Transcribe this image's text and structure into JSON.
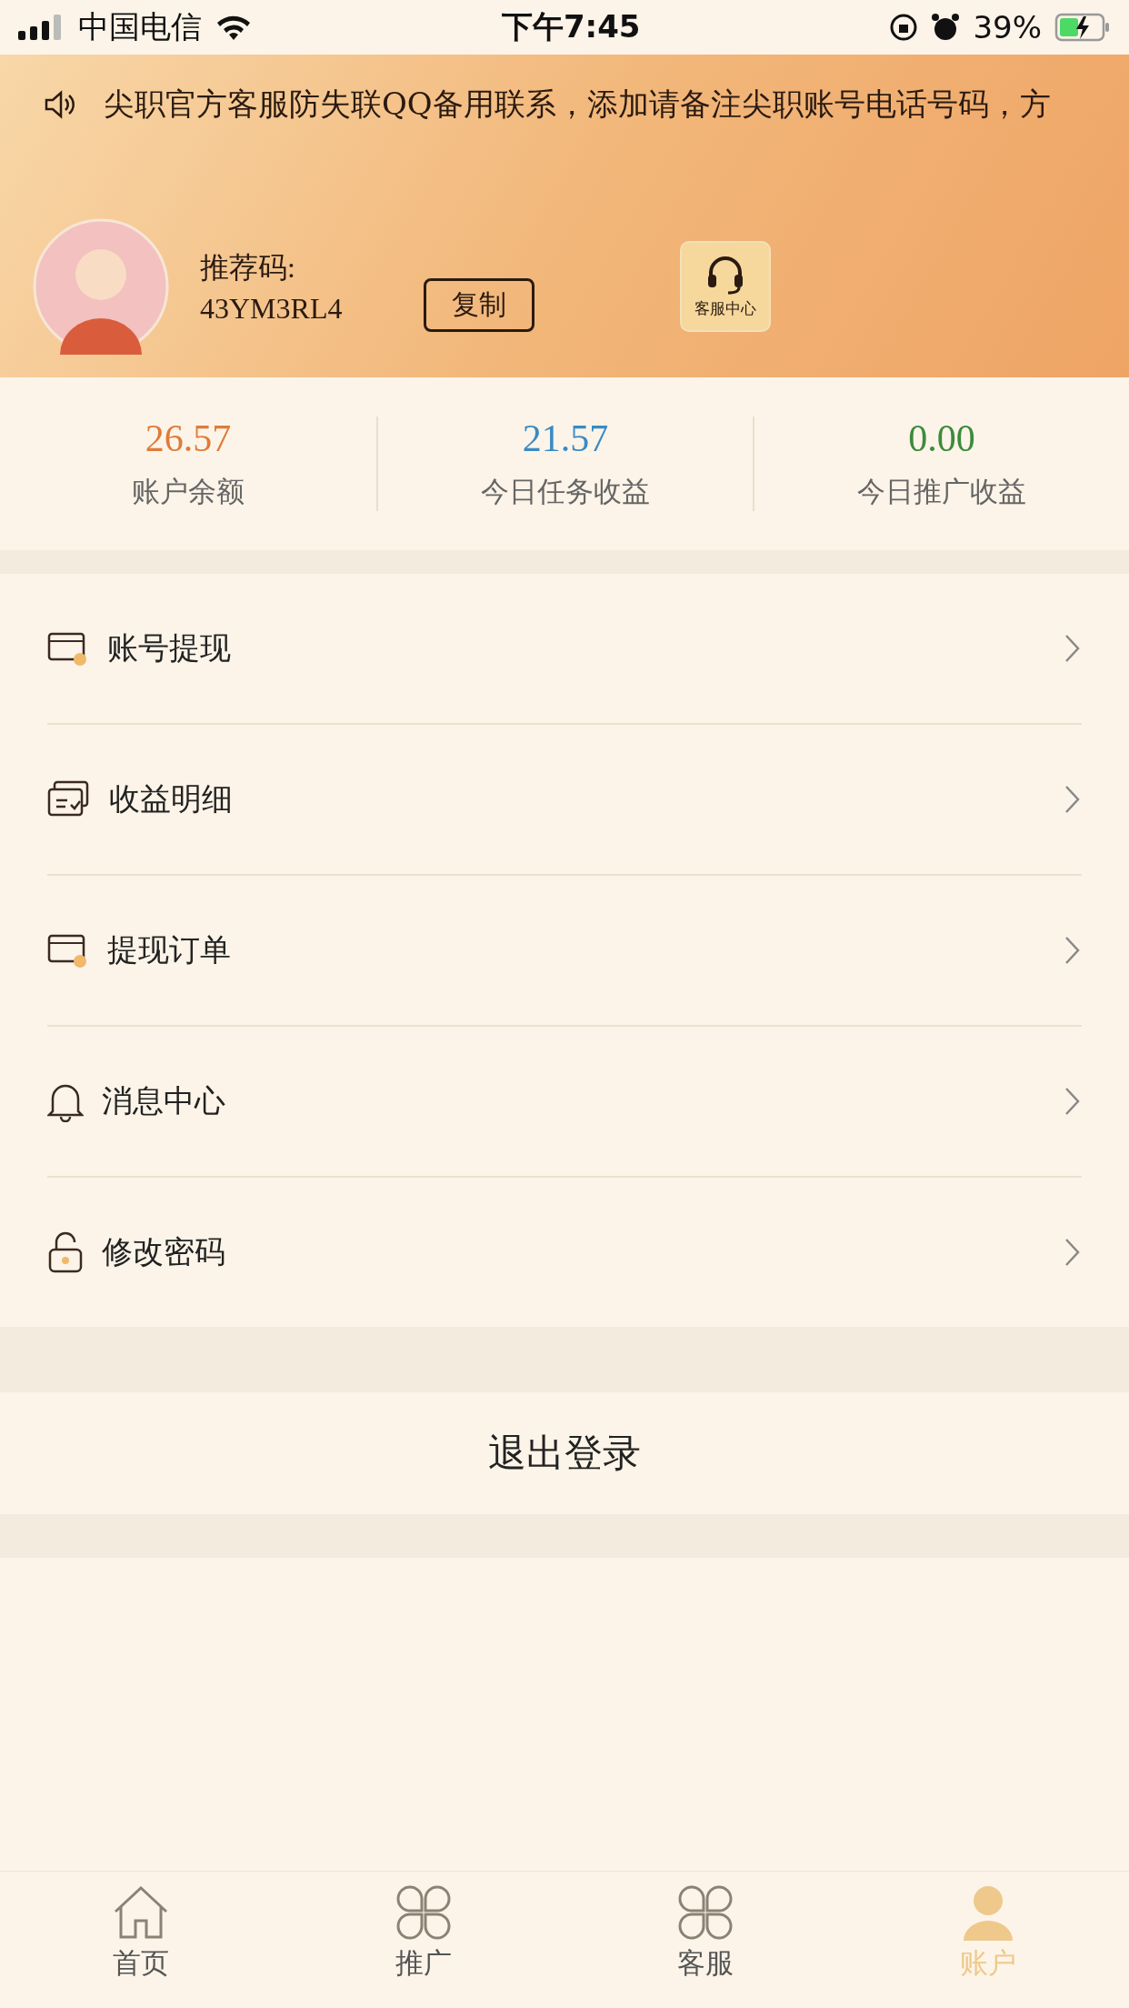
{
  "status_bar": {
    "carrier": "中国电信",
    "time": "下午7:45",
    "battery": "39%"
  },
  "notice": {
    "text": "尖职官方客服防失联QQ备用联系，添加请备注尖职账号电话号码，方"
  },
  "profile": {
    "code_label": "推荐码:",
    "code": "43YM3RL4",
    "copy_button": "复制",
    "service_button": "客服中心"
  },
  "stats": [
    {
      "value": "26.57",
      "label": "账户余额",
      "color": "#e07b39"
    },
    {
      "value": "21.57",
      "label": "今日任务收益",
      "color": "#3a8ac4"
    },
    {
      "value": "0.00",
      "label": "今日推广收益",
      "color": "#3f8a3c"
    }
  ],
  "menu": [
    {
      "label": "账号提现",
      "kind": "card"
    },
    {
      "label": "收益明细",
      "kind": "list"
    },
    {
      "label": "提现订单",
      "kind": "card"
    },
    {
      "label": "消息中心",
      "kind": "bell"
    },
    {
      "label": "修改密码",
      "kind": "lock"
    }
  ],
  "logout": "退出登录",
  "tabs": [
    {
      "label": "首页",
      "kind": "home",
      "selected": false
    },
    {
      "label": "推广",
      "kind": "grid",
      "selected": false
    },
    {
      "label": "客服",
      "kind": "grid",
      "selected": false
    },
    {
      "label": "账户",
      "kind": "user",
      "selected": true
    }
  ]
}
